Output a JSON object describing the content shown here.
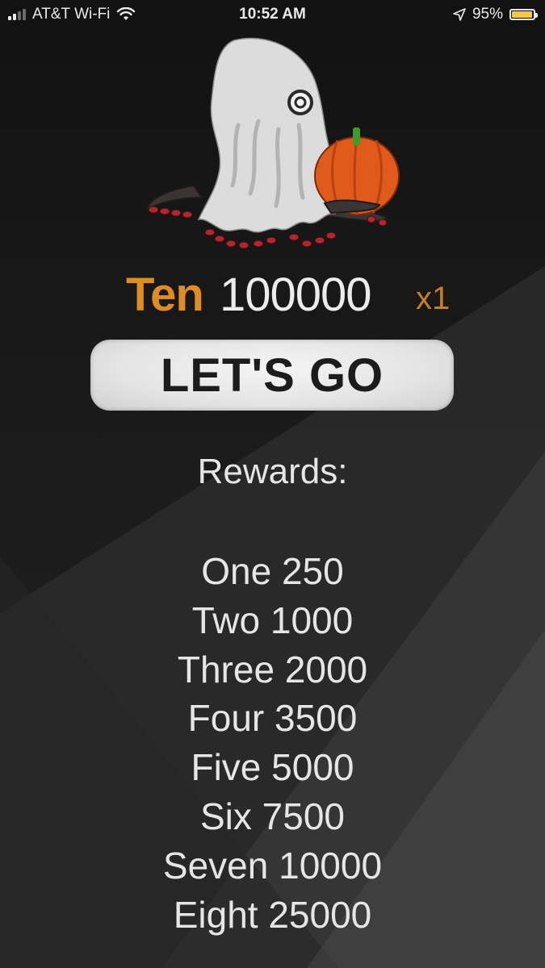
{
  "status_bar": {
    "carrier": "AT&T Wi-Fi",
    "time": "10:52 AM",
    "battery_percent": "95%",
    "battery_level": 0.95,
    "icons": [
      "signal-icon",
      "wifi-icon",
      "location-arrow-icon",
      "battery-icon"
    ]
  },
  "mascot": {
    "icon": "ghost-octopus-with-pumpkin-icon"
  },
  "level": {
    "name": "Ten",
    "target": "100000",
    "multiplier": "x1"
  },
  "button": {
    "label": "LET'S GO"
  },
  "rewards": {
    "title": "Rewards:",
    "items": [
      {
        "label": "One 250"
      },
      {
        "label": "Two 1000"
      },
      {
        "label": "Three 2000"
      },
      {
        "label": "Four 3500"
      },
      {
        "label": "Five 5000"
      },
      {
        "label": "Six 7500"
      },
      {
        "label": "Seven 10000"
      },
      {
        "label": "Eight 25000"
      }
    ]
  },
  "colors": {
    "accent_orange": "#de8d25",
    "battery_yellow": "#f2c84b",
    "text_light": "#e6e6e6",
    "background": "#151515"
  }
}
